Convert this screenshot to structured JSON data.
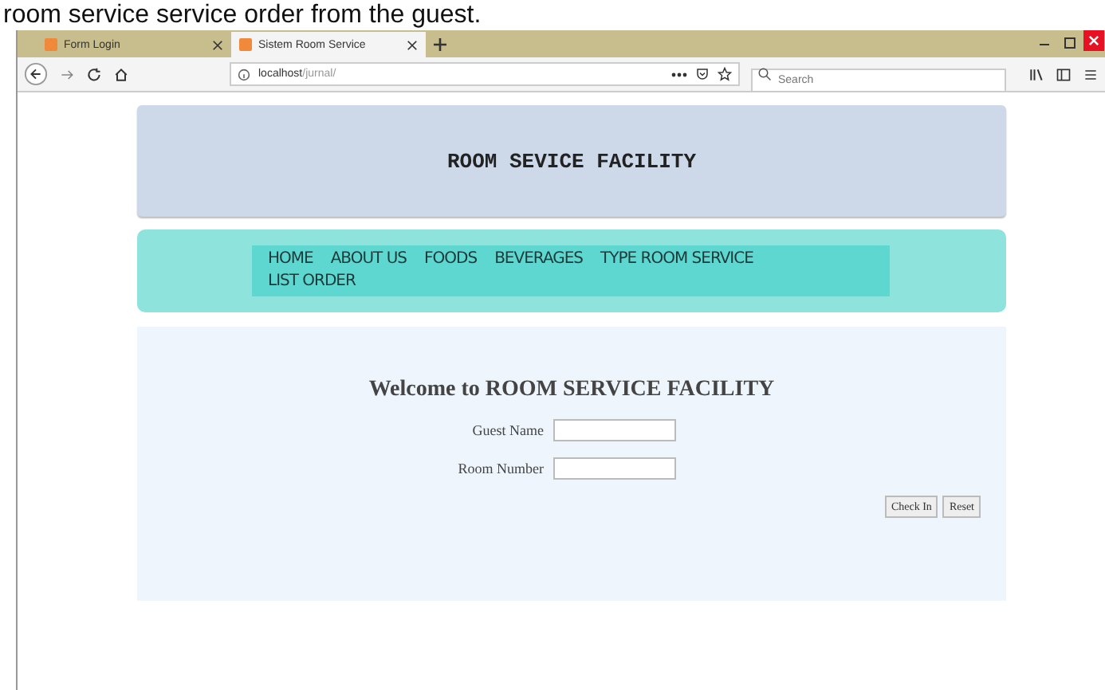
{
  "caption": "room service service order from the guest.",
  "tabs": [
    {
      "label": "Form Login",
      "selected": false
    },
    {
      "label": "Sistem Room Service",
      "selected": true
    }
  ],
  "address": {
    "host": "localhost",
    "path": "/jurnal/"
  },
  "search": {
    "placeholder": "Search"
  },
  "page": {
    "title": "ROOM SEVICE FACILITY",
    "nav": [
      "HOME",
      "ABOUT US",
      "FOODS",
      "BEVERAGES",
      "TYPE ROOM SERVICE",
      "LIST ORDER"
    ],
    "welcome": "Welcome to ROOM SERVICE FACILITY",
    "fields": [
      {
        "label": "Guest Name"
      },
      {
        "label": "Room Number"
      }
    ],
    "buttons": [
      "Check In",
      "Reset"
    ]
  }
}
